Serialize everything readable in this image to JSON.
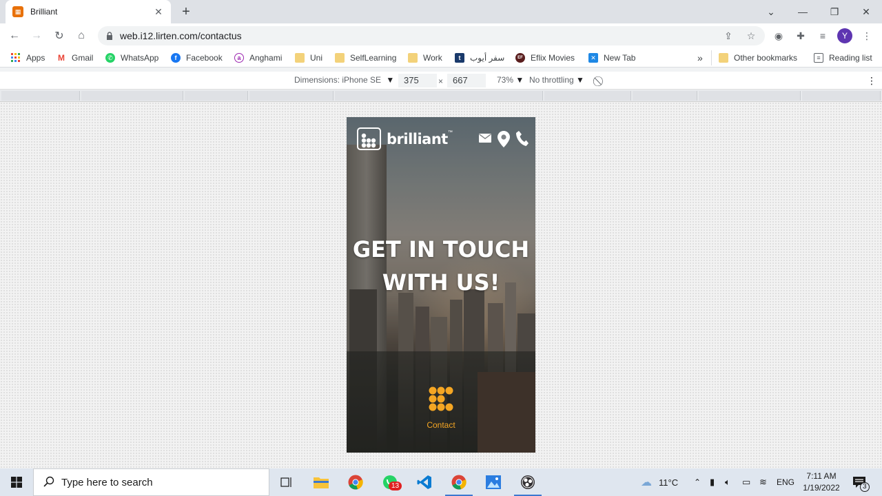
{
  "browser": {
    "tab_title": "Brilliant",
    "url": "web.i12.lirten.com/contactus",
    "profile_initial": "Y"
  },
  "bookmarks": [
    {
      "label": "Apps",
      "icon": "apps-grid-icon"
    },
    {
      "label": "Gmail",
      "icon": "gmail-icon"
    },
    {
      "label": "WhatsApp",
      "icon": "whatsapp-icon"
    },
    {
      "label": "Facebook",
      "icon": "facebook-icon"
    },
    {
      "label": "Anghami",
      "icon": "anghami-icon"
    },
    {
      "label": "Uni",
      "icon": "folder-icon"
    },
    {
      "label": "SelfLearning",
      "icon": "folder-icon"
    },
    {
      "label": "Work",
      "icon": "folder-icon"
    },
    {
      "label": "سفر أيوب",
      "icon": "t-icon"
    },
    {
      "label": "Eflix Movies",
      "icon": "eflix-icon"
    },
    {
      "label": "New Tab",
      "icon": "newtab-icon"
    }
  ],
  "bookmarks_more": "»",
  "other_bookmarks": "Other bookmarks",
  "reading_list": "Reading list",
  "device_toolbar": {
    "dimensions_label": "Dimensions: iPhone SE",
    "width": "375",
    "times": "×",
    "height": "667",
    "zoom": "73%",
    "throttling": "No throttling"
  },
  "site": {
    "brand": "brilliant",
    "trademark": "™",
    "headline_line1": "GET IN TOUCH",
    "headline_line2": "WITH US!",
    "contact_label": "Contact",
    "accent_color": "#f5a623"
  },
  "taskbar": {
    "search_placeholder": "Type here to search",
    "whatsapp_badge": "13",
    "weather": "11°C",
    "language": "ENG",
    "time": "7:11 AM",
    "date": "1/19/2022",
    "notifications": "3"
  }
}
